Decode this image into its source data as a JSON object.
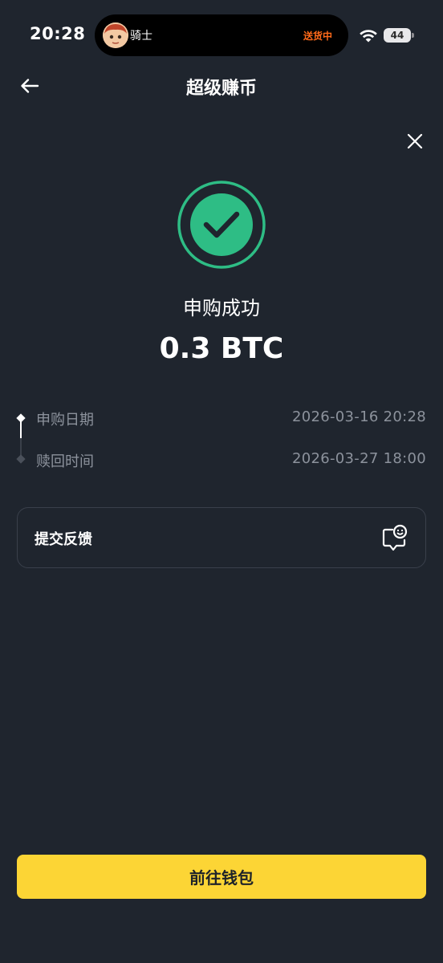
{
  "status_bar": {
    "time": "20:28",
    "island_user": "骑士",
    "island_status": "送货中",
    "battery": "44"
  },
  "header": {
    "title": "超级赚币"
  },
  "result": {
    "title": "申购成功",
    "amount": "0.3 BTC"
  },
  "timeline": [
    {
      "label": "申购日期",
      "value": "2026-03-16 20:28"
    },
    {
      "label": "赎回时间",
      "value": "2026-03-27 18:00"
    }
  ],
  "feedback": {
    "label": "提交反馈"
  },
  "actions": {
    "wallet_label": "前往钱包"
  },
  "colors": {
    "background": "#1f252e",
    "accent_green": "#2ebd85",
    "button_yellow": "#fcd535",
    "island_orange": "#ff6a1a"
  },
  "icons": [
    "back-arrow-icon",
    "close-icon",
    "check-circle-icon",
    "feedback-chat-icon",
    "wifi-icon",
    "avatar"
  ]
}
